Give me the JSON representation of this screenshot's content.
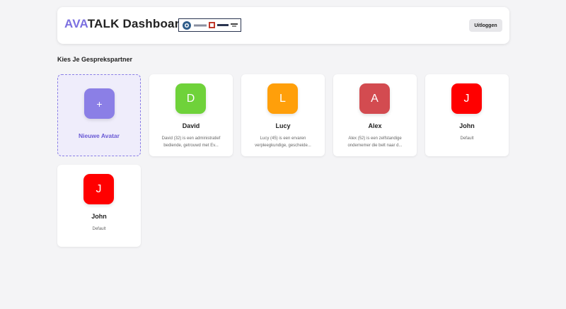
{
  "header": {
    "brand_highlight": "AVA",
    "brand_rest": "TALK Dashboard",
    "logout_label": "Uitloggen"
  },
  "section": {
    "title": "Kies Je Gesprekspartner"
  },
  "new_avatar": {
    "icon": "+",
    "label": "Nieuwe Avatar"
  },
  "avatars": [
    {
      "initial": "D",
      "name": "David",
      "description": "David (32) is een administratief bediende, getrouwd met Ev...",
      "color": "#6fd23a"
    },
    {
      "initial": "L",
      "name": "Lucy",
      "description": "Lucy (45) is een ervaren verpleegkundige, gescheide...",
      "color": "#ff9f0a"
    },
    {
      "initial": "A",
      "name": "Alex",
      "description": "Alex (52) is een zelfstandige ondernemer die belt naar d...",
      "color": "#d34b50"
    },
    {
      "initial": "J",
      "name": "John",
      "description": "Default",
      "color": "#ff0000"
    },
    {
      "initial": "J",
      "name": "John",
      "description": "Default",
      "color": "#ff0000"
    }
  ],
  "colors": {
    "accent": "#7b6fe0",
    "new_tile": "#8b7fe6"
  }
}
